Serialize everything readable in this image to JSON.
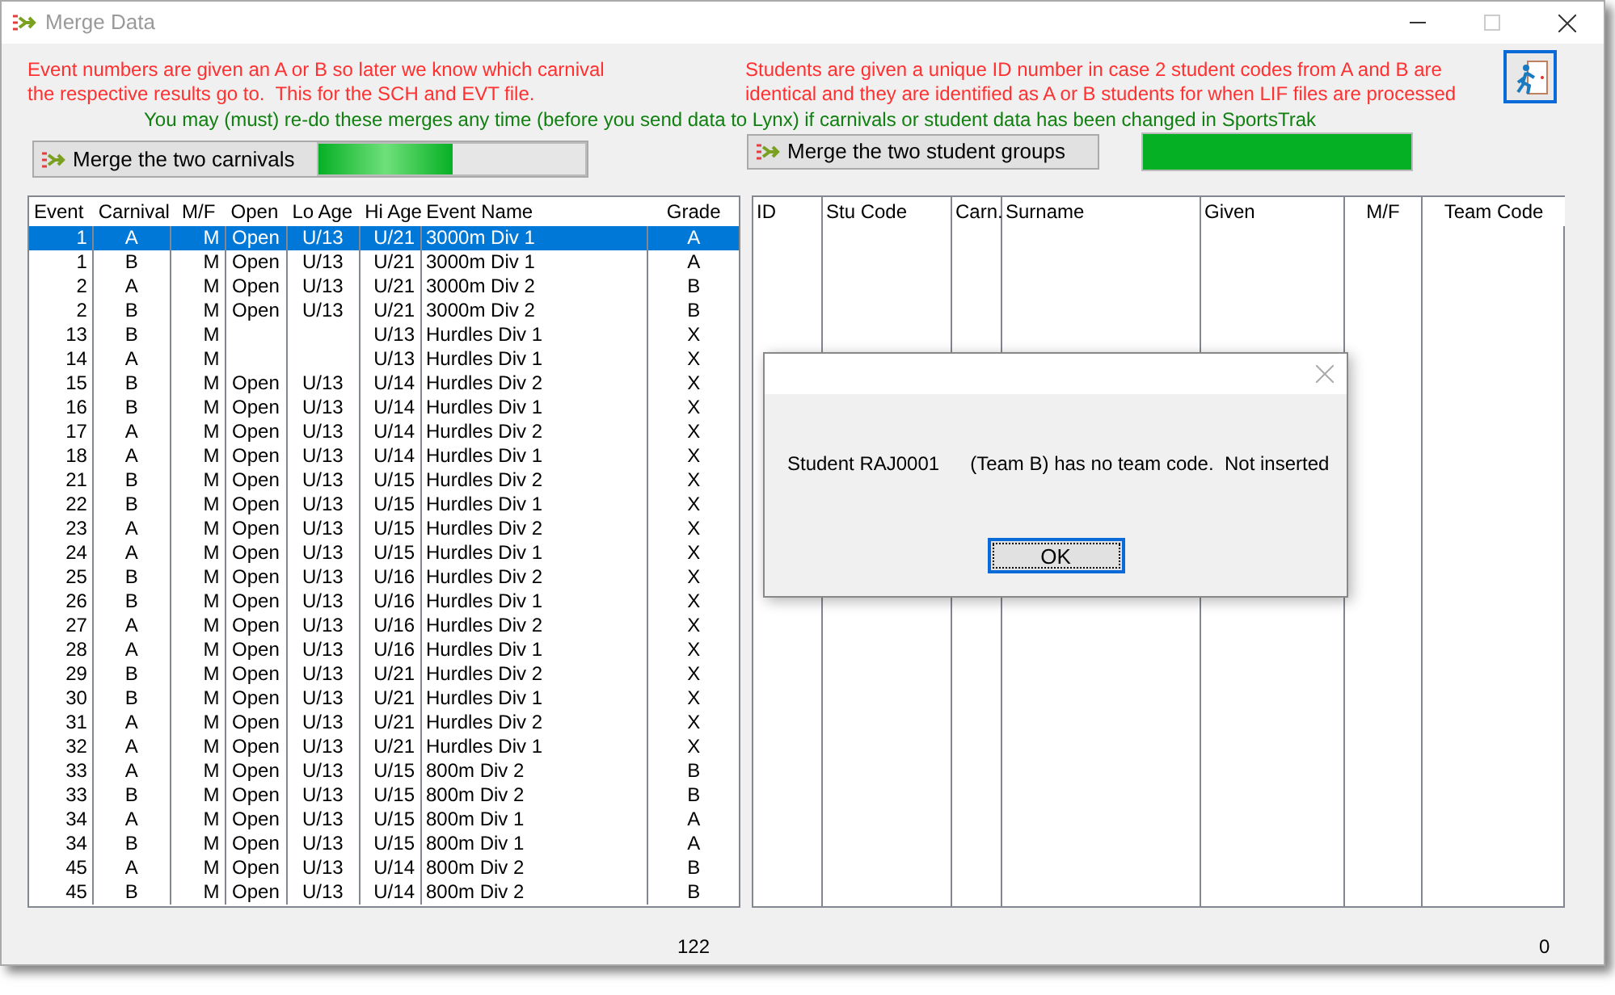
{
  "window": {
    "title": "Merge Data"
  },
  "notes": {
    "events_note": "Event numbers are given an A or B so later we know which carnival the respective results go to.  This for the SCH and EVT file.",
    "students_note": "Students are given a unique ID number in case 2 student codes from A and B are identical and they are identified as A or B students for when LIF files are processed",
    "redo_note": "You may (must) re-do these merges any time (before you send data to Lynx) if carnivals or student data has been changed in SportsTrak"
  },
  "carnival_merge": {
    "button": "Merge the two carnivals",
    "level": 0.5
  },
  "student_merge": {
    "button": "Merge the two student groups",
    "level": 1
  },
  "events_table": {
    "columns": [
      "Event",
      "Carnival",
      "M/F",
      "Open",
      "Lo Age",
      "Hi Age",
      "Event Name",
      "Grade"
    ],
    "rows": [
      {
        "cells": [
          "1",
          "A",
          "M",
          "Open",
          "U/13",
          "U/21",
          "3000m Div 1",
          "A"
        ],
        "selected": true
      },
      {
        "cells": [
          "1",
          "B",
          "M",
          "Open",
          "U/13",
          "U/21",
          "3000m Div 1",
          "A"
        ],
        "selected": false
      },
      {
        "cells": [
          "2",
          "A",
          "M",
          "Open",
          "U/13",
          "U/21",
          "3000m Div 2",
          "B"
        ],
        "selected": false
      },
      {
        "cells": [
          "2",
          "B",
          "M",
          "Open",
          "U/13",
          "U/21",
          "3000m Div 2",
          "B"
        ],
        "selected": false
      },
      {
        "cells": [
          "13",
          "B",
          "M",
          "",
          "",
          "U/13",
          "Hurdles Div 1",
          "X"
        ],
        "selected": false
      },
      {
        "cells": [
          "14",
          "A",
          "M",
          "",
          "",
          "U/13",
          "Hurdles Div 1",
          "X"
        ],
        "selected": false
      },
      {
        "cells": [
          "15",
          "B",
          "M",
          "Open",
          "U/13",
          "U/14",
          "Hurdles Div 2",
          "X"
        ],
        "selected": false
      },
      {
        "cells": [
          "16",
          "B",
          "M",
          "Open",
          "U/13",
          "U/14",
          "Hurdles Div 1",
          "X"
        ],
        "selected": false
      },
      {
        "cells": [
          "17",
          "A",
          "M",
          "Open",
          "U/13",
          "U/14",
          "Hurdles Div 2",
          "X"
        ],
        "selected": false
      },
      {
        "cells": [
          "18",
          "A",
          "M",
          "Open",
          "U/13",
          "U/14",
          "Hurdles Div 1",
          "X"
        ],
        "selected": false
      },
      {
        "cells": [
          "21",
          "B",
          "M",
          "Open",
          "U/13",
          "U/15",
          "Hurdles Div 2",
          "X"
        ],
        "selected": false
      },
      {
        "cells": [
          "22",
          "B",
          "M",
          "Open",
          "U/13",
          "U/15",
          "Hurdles Div 1",
          "X"
        ],
        "selected": false
      },
      {
        "cells": [
          "23",
          "A",
          "M",
          "Open",
          "U/13",
          "U/15",
          "Hurdles Div 2",
          "X"
        ],
        "selected": false
      },
      {
        "cells": [
          "24",
          "A",
          "M",
          "Open",
          "U/13",
          "U/15",
          "Hurdles Div 1",
          "X"
        ],
        "selected": false
      },
      {
        "cells": [
          "25",
          "B",
          "M",
          "Open",
          "U/13",
          "U/16",
          "Hurdles Div 2",
          "X"
        ],
        "selected": false
      },
      {
        "cells": [
          "26",
          "B",
          "M",
          "Open",
          "U/13",
          "U/16",
          "Hurdles Div 1",
          "X"
        ],
        "selected": false
      },
      {
        "cells": [
          "27",
          "A",
          "M",
          "Open",
          "U/13",
          "U/16",
          "Hurdles Div 2",
          "X"
        ],
        "selected": false
      },
      {
        "cells": [
          "28",
          "A",
          "M",
          "Open",
          "U/13",
          "U/16",
          "Hurdles Div 1",
          "X"
        ],
        "selected": false
      },
      {
        "cells": [
          "29",
          "B",
          "M",
          "Open",
          "U/13",
          "U/21",
          "Hurdles Div 2",
          "X"
        ],
        "selected": false
      },
      {
        "cells": [
          "30",
          "B",
          "M",
          "Open",
          "U/13",
          "U/21",
          "Hurdles Div 1",
          "X"
        ],
        "selected": false
      },
      {
        "cells": [
          "31",
          "A",
          "M",
          "Open",
          "U/13",
          "U/21",
          "Hurdles Div 2",
          "X"
        ],
        "selected": false
      },
      {
        "cells": [
          "32",
          "A",
          "M",
          "Open",
          "U/13",
          "U/21",
          "Hurdles Div 1",
          "X"
        ],
        "selected": false
      },
      {
        "cells": [
          "33",
          "A",
          "M",
          "Open",
          "U/13",
          "U/15",
          "800m Div 2",
          "B"
        ],
        "selected": false
      },
      {
        "cells": [
          "33",
          "B",
          "M",
          "Open",
          "U/13",
          "U/15",
          "800m Div 2",
          "B"
        ],
        "selected": false
      },
      {
        "cells": [
          "34",
          "A",
          "M",
          "Open",
          "U/13",
          "U/15",
          "800m Div 1",
          "A"
        ],
        "selected": false
      },
      {
        "cells": [
          "34",
          "B",
          "M",
          "Open",
          "U/13",
          "U/15",
          "800m Div 1",
          "A"
        ],
        "selected": false
      },
      {
        "cells": [
          "45",
          "A",
          "M",
          "Open",
          "U/13",
          "U/14",
          "800m Div 2",
          "B"
        ],
        "selected": false
      },
      {
        "cells": [
          "45",
          "B",
          "M",
          "Open",
          "U/13",
          "U/14",
          "800m Div 2",
          "B"
        ],
        "selected": false
      }
    ],
    "count": "122"
  },
  "students_table": {
    "columns": [
      "ID",
      "Stu Code",
      "Carn.",
      "Surname",
      "Given",
      "M/F",
      "Team Code"
    ],
    "count": "0"
  },
  "dialog": {
    "message_code": "Student RAJ0001",
    "message_text": "(Team B) has no team code.  Not inserted",
    "ok": "OK"
  }
}
